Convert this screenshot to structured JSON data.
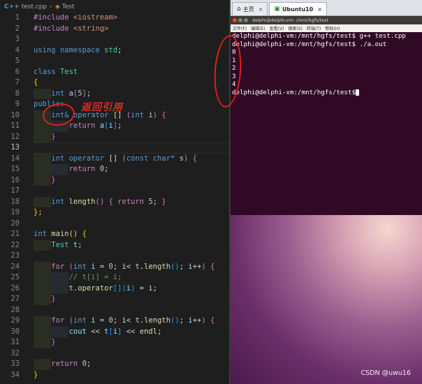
{
  "editor": {
    "tab_file": "test.cpp",
    "breadcrumb_symbol": "Test",
    "annotation": "返回引用",
    "lines": [
      {
        "n": "1"
      },
      {
        "n": "2"
      },
      {
        "n": "3"
      },
      {
        "n": "4"
      },
      {
        "n": "5"
      },
      {
        "n": "6"
      },
      {
        "n": "7"
      },
      {
        "n": "8"
      },
      {
        "n": "9"
      },
      {
        "n": "10"
      },
      {
        "n": "11"
      },
      {
        "n": "12"
      },
      {
        "n": "13"
      },
      {
        "n": "14"
      },
      {
        "n": "15"
      },
      {
        "n": "16"
      },
      {
        "n": "17"
      },
      {
        "n": "18"
      },
      {
        "n": "19"
      },
      {
        "n": "20"
      },
      {
        "n": "21"
      },
      {
        "n": "22"
      },
      {
        "n": "23"
      },
      {
        "n": "24"
      },
      {
        "n": "25"
      },
      {
        "n": "26"
      },
      {
        "n": "27"
      },
      {
        "n": "28"
      },
      {
        "n": "29"
      },
      {
        "n": "30"
      },
      {
        "n": "31"
      },
      {
        "n": "32"
      },
      {
        "n": "33"
      },
      {
        "n": "34"
      }
    ],
    "code": {
      "l1_a": "#include",
      "l1_b": "<iostream>",
      "l2_a": "#include",
      "l2_b": "<string>",
      "l4_a": "using",
      "l4_b": "namespace",
      "l4_c": "std",
      "l6_a": "class",
      "l6_b": "Test",
      "l7": "{",
      "l8_a": "int",
      "l8_b": "a",
      "l8_c": "5",
      "l9": "public:",
      "l10_a": "int&",
      "l10_b": "operator",
      "l10_c": "[]",
      "l10_d": "int",
      "l10_e": "i",
      "l11_a": "return",
      "l11_b": "a",
      "l11_c": "i",
      "l12": "}",
      "l14_a": "int",
      "l14_b": "operator",
      "l14_c": "[]",
      "l14_d": "const",
      "l14_e": "char*",
      "l14_f": "s",
      "l15_a": "return",
      "l15_b": "0",
      "l16": "}",
      "l18_a": "int",
      "l18_b": "length",
      "l18_c": "return",
      "l18_d": "5",
      "l19": "};",
      "l21_a": "int",
      "l21_b": "main",
      "l22_a": "Test",
      "l22_b": "t",
      "l24_a": "for",
      "l24_b": "int",
      "l24_c": "i",
      "l24_d": "0",
      "l24_e": "i",
      "l24_f": "t",
      "l24_g": "length",
      "l24_h": "i",
      "l25": "// t[i] = i;",
      "l26_a": "t",
      "l26_b": "operator",
      "l26_c": "i",
      "l26_d": "i",
      "l27": "}",
      "l29_a": "for",
      "l29_b": "int",
      "l29_c": "i",
      "l29_d": "0",
      "l29_e": "i",
      "l29_f": "t",
      "l29_g": "length",
      "l29_h": "i",
      "l30_a": "cout",
      "l30_b": "t",
      "l30_c": "i",
      "l30_d": "endl",
      "l31": "}",
      "l33_a": "return",
      "l33_b": "0",
      "l34": "}"
    }
  },
  "vm": {
    "tab_home": "主页",
    "tab_vm": "Ubuntu10",
    "window_title": "delphi@delphi-vm: /mnt/hgfs/test",
    "menu": [
      "文件(F)",
      "编辑(E)",
      "查看(V)",
      "搜索(S)",
      "终端(T)",
      "帮助(H)"
    ],
    "terminal_lines": [
      "delphi@delphi-vm:/mnt/hgfs/test$ g++ test.cpp",
      "delphi@delphi-vm:/mnt/hgfs/test$ ./a.out",
      "0",
      "1",
      "2",
      "3",
      "4",
      "delphi@delphi-vm:/mnt/hgfs/test$"
    ],
    "watermark": "CSDN @uwu16"
  },
  "colors": {
    "editor_bg": "#1e1e1e",
    "terminal_bg": "#300a24",
    "annotation": "#e0201a"
  }
}
